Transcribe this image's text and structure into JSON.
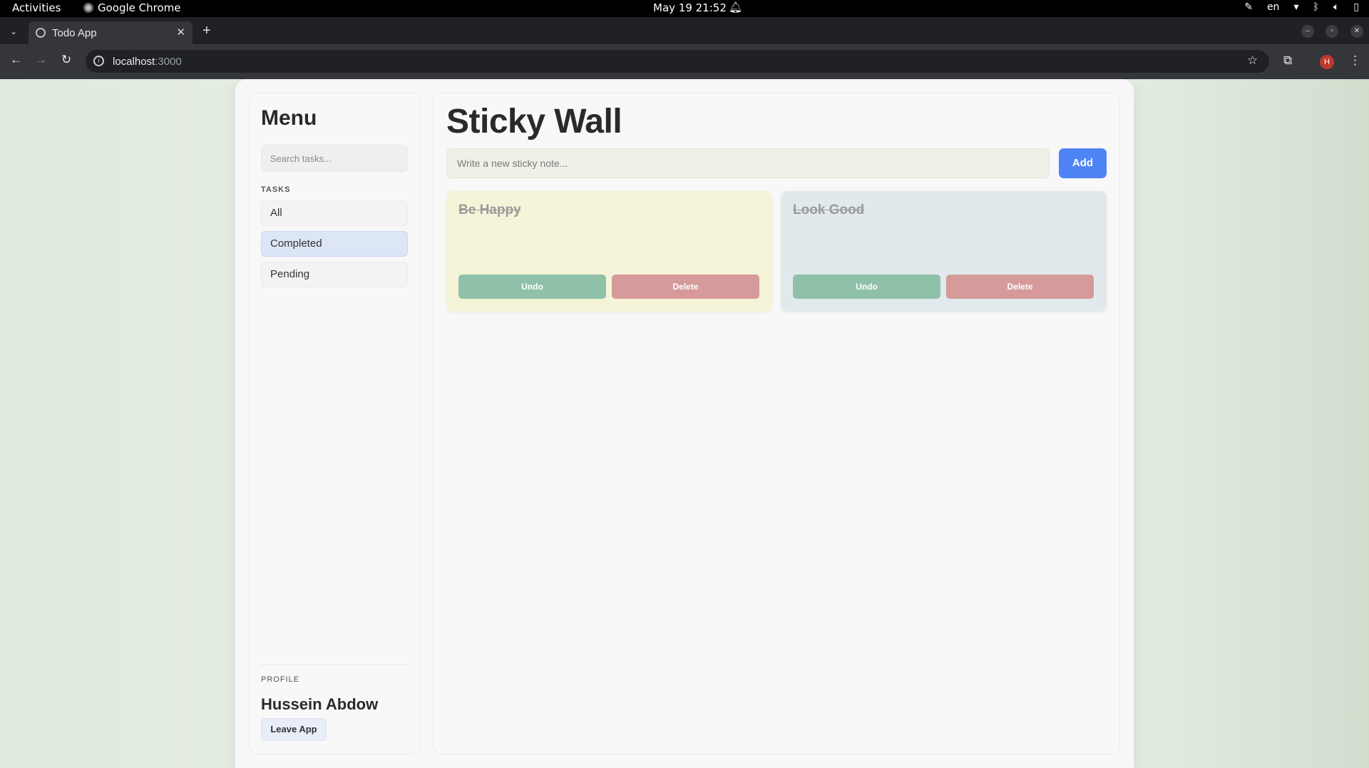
{
  "system_bar": {
    "activities": "Activities",
    "app_name": "Google Chrome",
    "datetime": "May 19  21:52",
    "language": "en"
  },
  "browser": {
    "tab_title": "Todo App",
    "url_host": "localhost",
    "url_port": ":3000",
    "profile_initial": "H"
  },
  "sidebar": {
    "title": "Menu",
    "search_placeholder": "Search tasks...",
    "tasks_label": "TASKS",
    "items": [
      {
        "label": "All",
        "active": false
      },
      {
        "label": "Completed",
        "active": true
      },
      {
        "label": "Pending",
        "active": false
      }
    ],
    "profile_label": "PROFILE",
    "profile_name": "Hussein Abdow",
    "leave_label": "Leave App"
  },
  "main": {
    "title": "Sticky Wall",
    "input_placeholder": "Write a new sticky note...",
    "add_label": "Add",
    "notes": [
      {
        "title": "Be Happy",
        "completed": true,
        "color": "#f5f3d8",
        "undo_label": "Undo",
        "delete_label": "Delete"
      },
      {
        "title": "Look Good",
        "completed": true,
        "color": "#e1e9ec",
        "undo_label": "Undo",
        "delete_label": "Delete"
      }
    ]
  },
  "colors": {
    "accent": "#4f84f6",
    "undo": "#8fc1a9",
    "delete": "#d69a9a",
    "active_nav": "#dde6f7"
  }
}
